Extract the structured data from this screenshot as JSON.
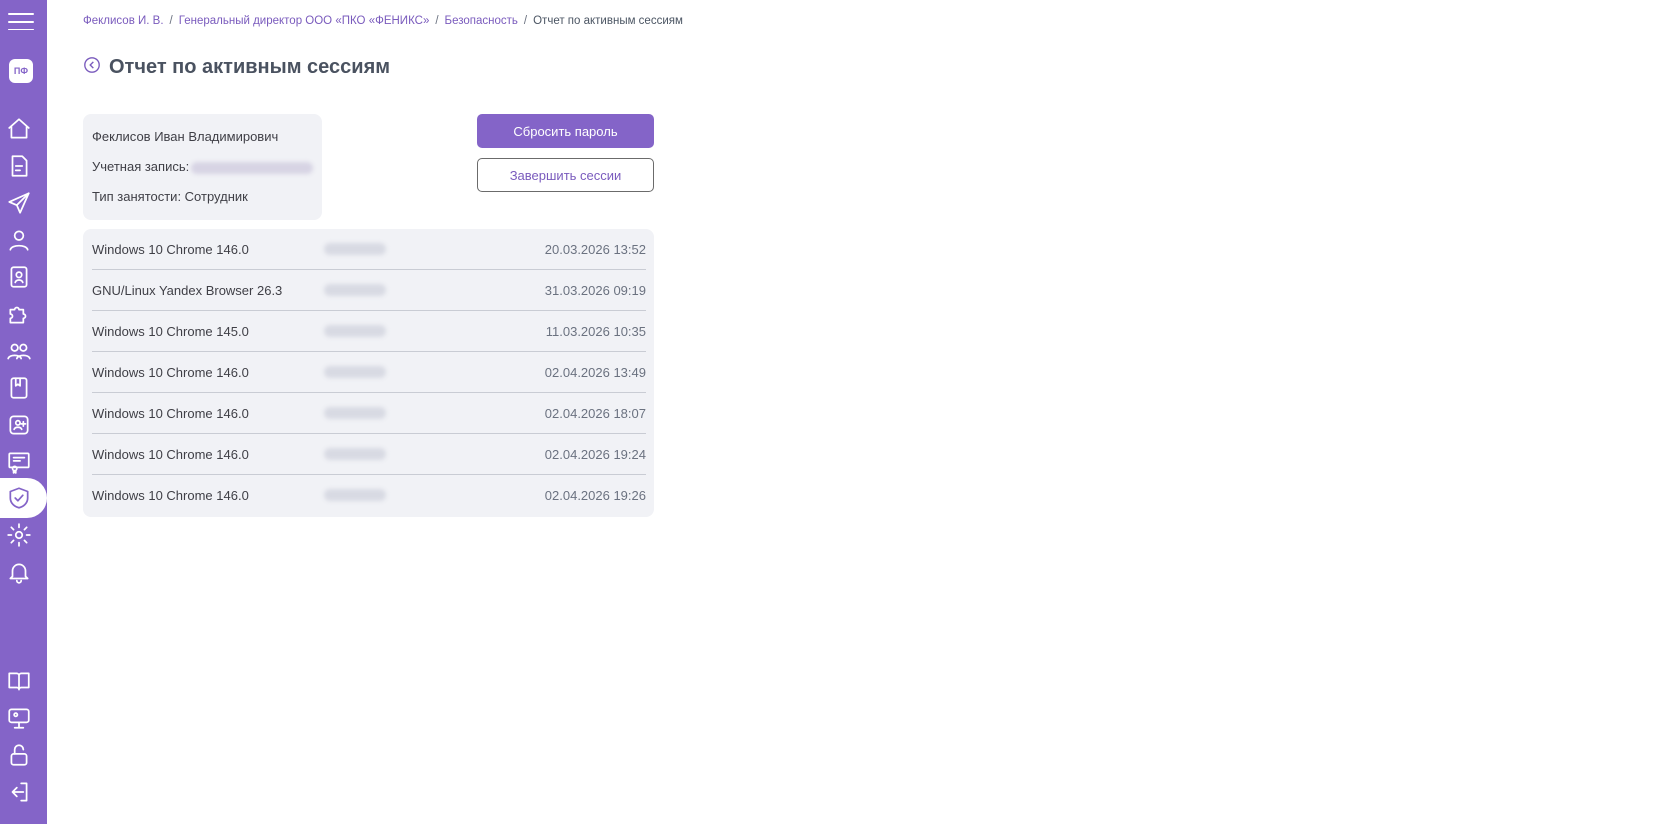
{
  "sidebar": {
    "logo": "ПФ",
    "icons": [
      "menu-icon",
      "home-icon",
      "document-icon",
      "send-icon",
      "user-icon",
      "badge-icon",
      "puzzle-icon",
      "team-icon",
      "book-icon",
      "contact-icon",
      "certificate-icon",
      "shield-check-icon",
      "gear-icon",
      "bell-icon",
      "open-book-icon",
      "presentation-icon",
      "lock-open-icon",
      "logout-icon"
    ],
    "active": "shield-check-icon",
    "accent": "#8464c8"
  },
  "breadcrumb": {
    "items": [
      "Феклисов И. В.",
      "Генеральный директор ООО «ПКО «ФЕНИКС»",
      "Безопасность"
    ],
    "current": "Отчет по активным сессиям",
    "separator": "/"
  },
  "page": {
    "title": "Отчет по активным сессиям"
  },
  "user": {
    "name": "Феклисов Иван Владимирович",
    "account_label": "Учетная запись:",
    "employment": "Тип занятости: Сотрудник"
  },
  "actions": {
    "reset_password": "Сбросить пароль",
    "end_sessions": "Завершить сессии"
  },
  "sessions": [
    {
      "device": "Windows 10 Chrome 146.0",
      "date": "20.03.2026 13:52"
    },
    {
      "device": "GNU/Linux Yandex Browser 26.3",
      "date": "31.03.2026 09:19"
    },
    {
      "device": "Windows 10 Chrome 145.0",
      "date": "11.03.2026 10:35"
    },
    {
      "device": "Windows 10 Chrome 146.0",
      "date": "02.04.2026 13:49"
    },
    {
      "device": "Windows 10 Chrome 146.0",
      "date": "02.04.2026 18:07"
    },
    {
      "device": "Windows 10 Chrome 146.0",
      "date": "02.04.2026 19:24"
    },
    {
      "device": "Windows 10 Chrome 146.0",
      "date": "02.04.2026 19:26"
    }
  ]
}
